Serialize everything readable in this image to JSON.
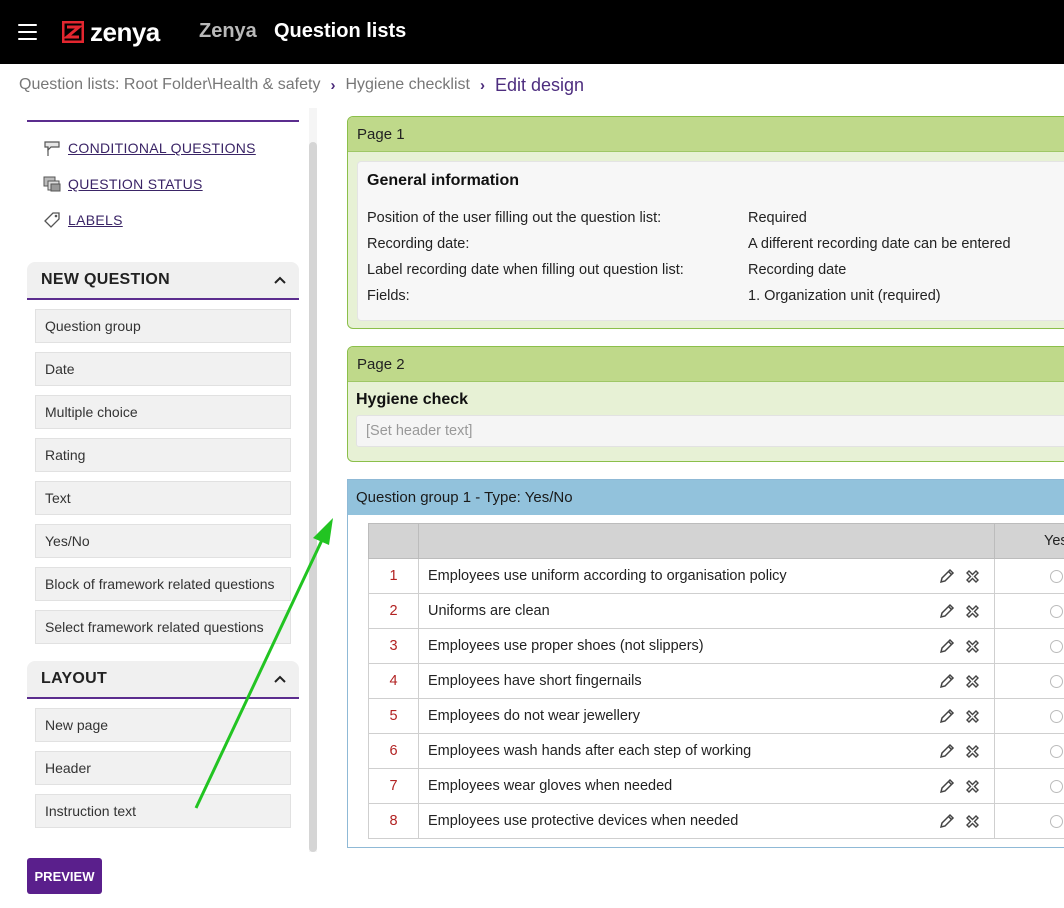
{
  "header": {
    "app_name": "Zenya",
    "title": "Question lists",
    "logo_text": "zenya"
  },
  "breadcrumb": {
    "items": [
      "Question lists: Root Folder\\Health & safety",
      "Hygiene checklist"
    ],
    "current": "Edit design"
  },
  "sidebar": {
    "links": [
      {
        "label": "CONDITIONAL QUESTIONS",
        "icon": "conditional-questions-icon"
      },
      {
        "label": "QUESTION STATUS",
        "icon": "question-status-icon"
      },
      {
        "label": "LABELS",
        "icon": "label-tag-icon"
      }
    ],
    "new_question": {
      "title": "NEW QUESTION",
      "items": [
        "Question group",
        "Date",
        "Multiple choice",
        "Rating",
        "Text",
        "Yes/No",
        "Block of framework related questions",
        "Select framework related questions"
      ]
    },
    "layout": {
      "title": "LAYOUT",
      "items": [
        "New page",
        "Header",
        "Instruction text"
      ]
    },
    "preview_label": "PREVIEW"
  },
  "page1": {
    "label": "Page 1",
    "card_title": "General information",
    "rows": [
      {
        "label": "Position of the user filling out the question list:",
        "value": "Required"
      },
      {
        "label": "Recording date:",
        "value": "A different recording date can be entered"
      },
      {
        "label": "Label recording date when filling out question list:",
        "value": "Recording date"
      },
      {
        "label": "Fields:",
        "value": "1. Organization unit (required)"
      }
    ]
  },
  "page2": {
    "label": "Page 2",
    "title": "Hygiene check",
    "header_placeholder": "[Set header text]"
  },
  "question_group": {
    "title": "Question group 1 - Type: Yes/No",
    "column_yes": "Yes",
    "questions": [
      {
        "num": "1",
        "text": "Employees use uniform according to organisation policy"
      },
      {
        "num": "2",
        "text": "Uniforms are clean"
      },
      {
        "num": "3",
        "text": "Employees use proper shoes (not slippers)"
      },
      {
        "num": "4",
        "text": "Employees have short fingernails"
      },
      {
        "num": "5",
        "text": "Employees do not wear jewellery"
      },
      {
        "num": "6",
        "text": "Employees wash hands after each step of working"
      },
      {
        "num": "7",
        "text": "Employees wear gloves when needed"
      },
      {
        "num": "8",
        "text": "Employees use protective devices when needed"
      }
    ]
  },
  "colors": {
    "brand_red": "#e3262f",
    "accent_purple": "#5a1f8c",
    "page_green": "#bfd98a",
    "group_blue": "#92c2dc",
    "arrow_green": "#22c422"
  }
}
